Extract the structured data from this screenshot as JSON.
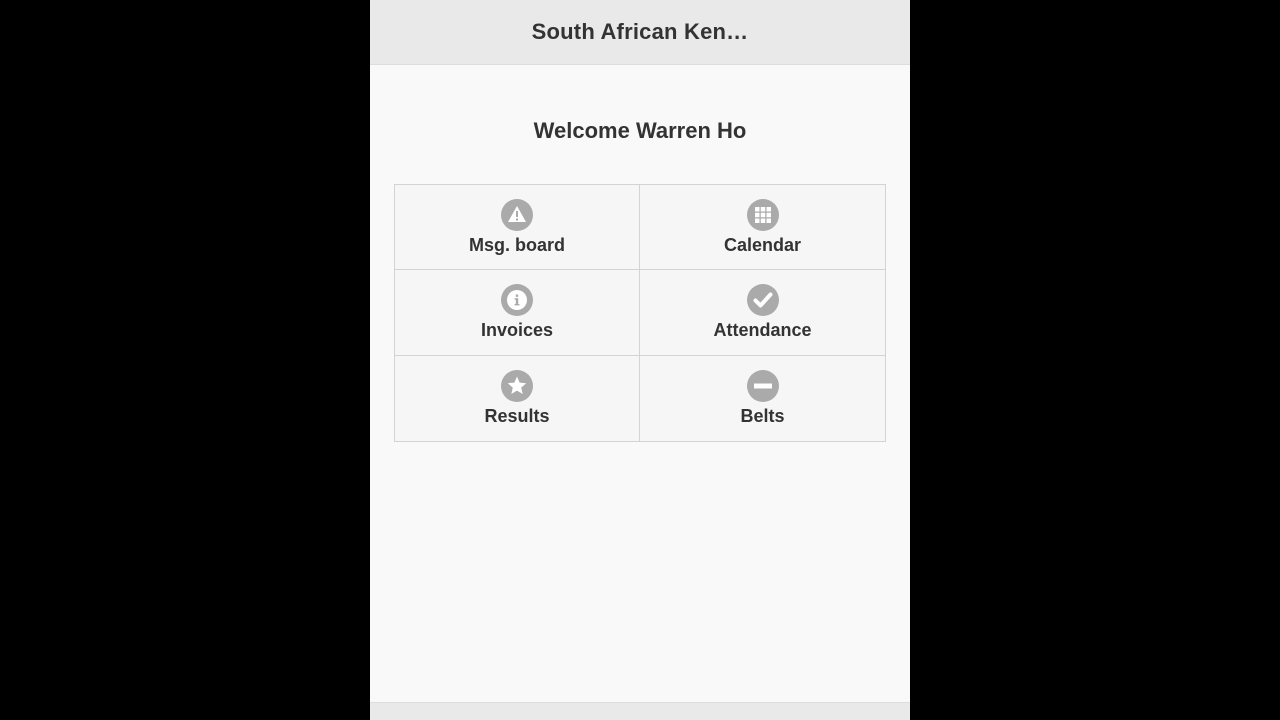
{
  "header": {
    "title": "South African Ken…"
  },
  "welcome": {
    "text": "Welcome Warren Ho"
  },
  "menu": {
    "items": [
      {
        "label": "Msg. board",
        "icon": "alert-icon"
      },
      {
        "label": "Calendar",
        "icon": "grid-icon"
      },
      {
        "label": "Invoices",
        "icon": "info-icon"
      },
      {
        "label": "Attendance",
        "icon": "check-icon"
      },
      {
        "label": "Results",
        "icon": "star-icon"
      },
      {
        "label": "Belts",
        "icon": "minus-icon"
      }
    ]
  },
  "colors": {
    "background": "#000000",
    "app_background": "#f9f9f9",
    "header_background": "#e9e9e9",
    "tile_background": "#f6f6f6",
    "icon_circle": "#aaaaaa",
    "text": "#333333"
  }
}
